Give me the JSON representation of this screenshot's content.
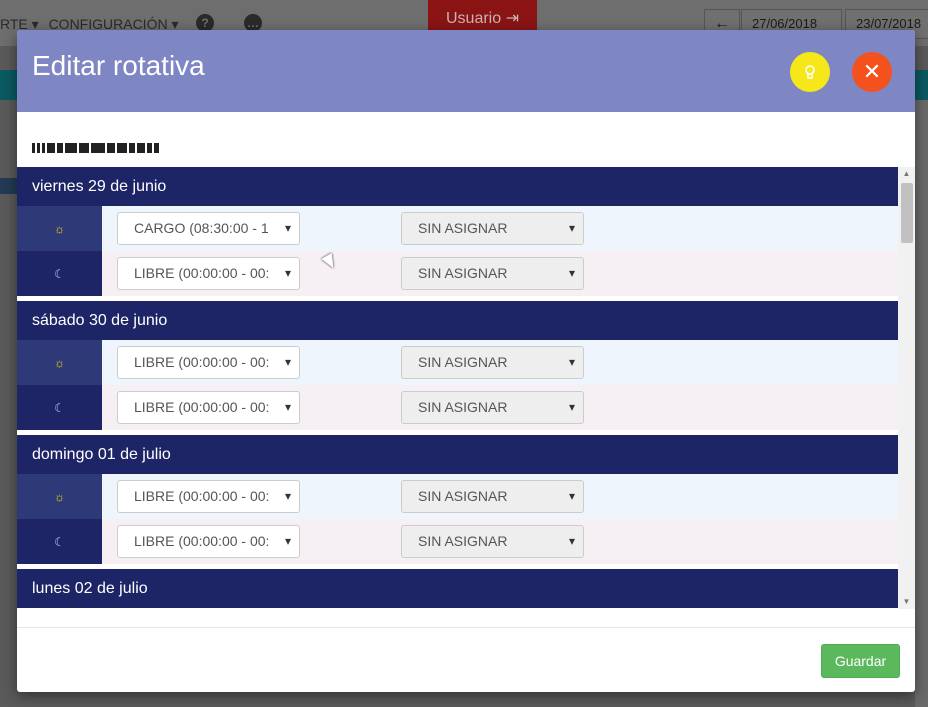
{
  "background": {
    "menu": [
      "RTE ▾",
      "CONFIGURACIÓN ▾"
    ],
    "help_icon": "question-icon",
    "chat_icon": "chat-icon",
    "user_button": "Usuario",
    "nav_back_icon": "arrow-left-icon",
    "date_from": "27/06/2018",
    "date_to": "23/07/2018"
  },
  "modal": {
    "title": "Editar rotativa",
    "hint_icon": "lightbulb-icon",
    "close_icon": "close-icon",
    "employee_name": "[redacted]",
    "days": [
      {
        "date": "viernes 29 de junio",
        "shifts": [
          {
            "icon": "sun-icon",
            "glyph": "☼",
            "type": "CARGO (08:30:00 - 1",
            "assign": "SIN ASIGNAR"
          },
          {
            "icon": "moon-icon",
            "glyph": "☾",
            "type": "LIBRE (00:00:00 - 00:",
            "assign": "SIN ASIGNAR"
          }
        ]
      },
      {
        "date": "sábado 30 de junio",
        "shifts": [
          {
            "icon": "sun-icon",
            "glyph": "☼",
            "type": "LIBRE (00:00:00 - 00:",
            "assign": "SIN ASIGNAR"
          },
          {
            "icon": "moon-icon",
            "glyph": "☾",
            "type": "LIBRE (00:00:00 - 00:",
            "assign": "SIN ASIGNAR"
          }
        ]
      },
      {
        "date": "domingo 01 de julio",
        "shifts": [
          {
            "icon": "sun-icon",
            "glyph": "☼",
            "type": "LIBRE (00:00:00 - 00:",
            "assign": "SIN ASIGNAR"
          },
          {
            "icon": "moon-icon",
            "glyph": "☾",
            "type": "LIBRE (00:00:00 - 00:",
            "assign": "SIN ASIGNAR"
          }
        ]
      },
      {
        "date": "lunes 02 de julio",
        "shifts": []
      }
    ],
    "save_label": "Guardar"
  },
  "colors": {
    "header": "#7e86c4",
    "day_header": "#1e2566",
    "close": "#f4511e",
    "hint": "#f5e71a",
    "save": "#5cb85c"
  }
}
